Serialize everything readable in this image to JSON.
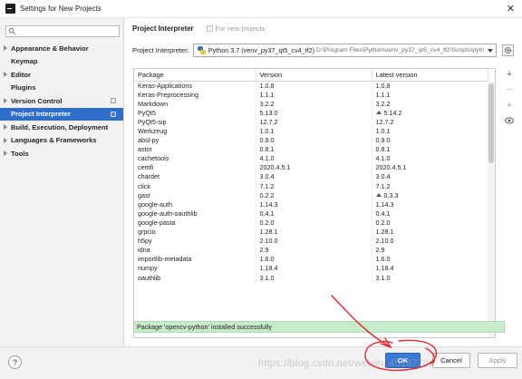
{
  "window": {
    "title": "Settings for New Projects",
    "close_glyph": "✕"
  },
  "sidebar": {
    "search_placeholder": "",
    "items": [
      {
        "label": "Appearance & Behavior",
        "expandable": true,
        "copy_icon": false
      },
      {
        "label": "Keymap",
        "expandable": false,
        "copy_icon": false
      },
      {
        "label": "Editor",
        "expandable": true,
        "copy_icon": false
      },
      {
        "label": "Plugins",
        "expandable": false,
        "copy_icon": false
      },
      {
        "label": "Version Control",
        "expandable": true,
        "copy_icon": true
      },
      {
        "label": "Project Interpreter",
        "expandable": false,
        "copy_icon": true,
        "selected": true
      },
      {
        "label": "Build, Execution, Deployment",
        "expandable": true,
        "copy_icon": false
      },
      {
        "label": "Languages & Frameworks",
        "expandable": true,
        "copy_icon": false
      },
      {
        "label": "Tools",
        "expandable": true,
        "copy_icon": false
      }
    ]
  },
  "main": {
    "title": "Project Interpreter",
    "for_new_projects": "For new projects",
    "interpreter_label": "Project Interpreter:",
    "interpreter_name": "Python 3.7 (venv_py37_qt5_cv4_tf2)",
    "interpreter_path": "D:\\Program Files\\Python\\venv_py37_qt5_cv4_tf2\\Scripts\\pyth",
    "table": {
      "headers": [
        "Package",
        "Version",
        "Latest version"
      ],
      "rows": [
        [
          "Keras-Applications",
          "1.0.8",
          "1.0.8",
          false
        ],
        [
          "Keras-Preprocessing",
          "1.1.1",
          "1.1.1",
          false
        ],
        [
          "Markdown",
          "3.2.2",
          "3.2.2",
          false
        ],
        [
          "PyQt5",
          "5.13.0",
          "5.14.2",
          true
        ],
        [
          "PyQt5-sip",
          "12.7.2",
          "12.7.2",
          false
        ],
        [
          "Werkzeug",
          "1.0.1",
          "1.0.1",
          false
        ],
        [
          "absl-py",
          "0.9.0",
          "0.9.0",
          false
        ],
        [
          "astor",
          "0.8.1",
          "0.8.1",
          false
        ],
        [
          "cachetools",
          "4.1.0",
          "4.1.0",
          false
        ],
        [
          "certifi",
          "2020.4.5.1",
          "2020.4.5.1",
          false
        ],
        [
          "chardet",
          "3.0.4",
          "3.0.4",
          false
        ],
        [
          "click",
          "7.1.2",
          "7.1.2",
          false
        ],
        [
          "gast",
          "0.2.2",
          "0.3.3",
          true
        ],
        [
          "google-auth",
          "1.14.3",
          "1.14.3",
          false
        ],
        [
          "google-auth-oauthlib",
          "0.4.1",
          "0.4.1",
          false
        ],
        [
          "google-pasta",
          "0.2.0",
          "0.2.0",
          false
        ],
        [
          "grpcio",
          "1.28.1",
          "1.28.1",
          false
        ],
        [
          "h5py",
          "2.10.0",
          "2.10.0",
          false
        ],
        [
          "idna",
          "2.9",
          "2.9",
          false
        ],
        [
          "importlib-metadata",
          "1.6.0",
          "1.6.0",
          false
        ],
        [
          "numpy",
          "1.18.4",
          "1.18.4",
          false
        ],
        [
          "oauthlib",
          "3.1.0",
          "3.1.0",
          false
        ]
      ]
    },
    "status_message": "Package 'opencv-python' installed successfully",
    "tools": {
      "add": "+",
      "remove": "−",
      "upgrade": "▲"
    }
  },
  "footer": {
    "help": "?",
    "ok": "OK",
    "cancel": "Cancel",
    "apply": "Apply"
  },
  "watermark": "https://blog.csdn.net/weixin_45137708",
  "annotation_color": "#e8262b"
}
